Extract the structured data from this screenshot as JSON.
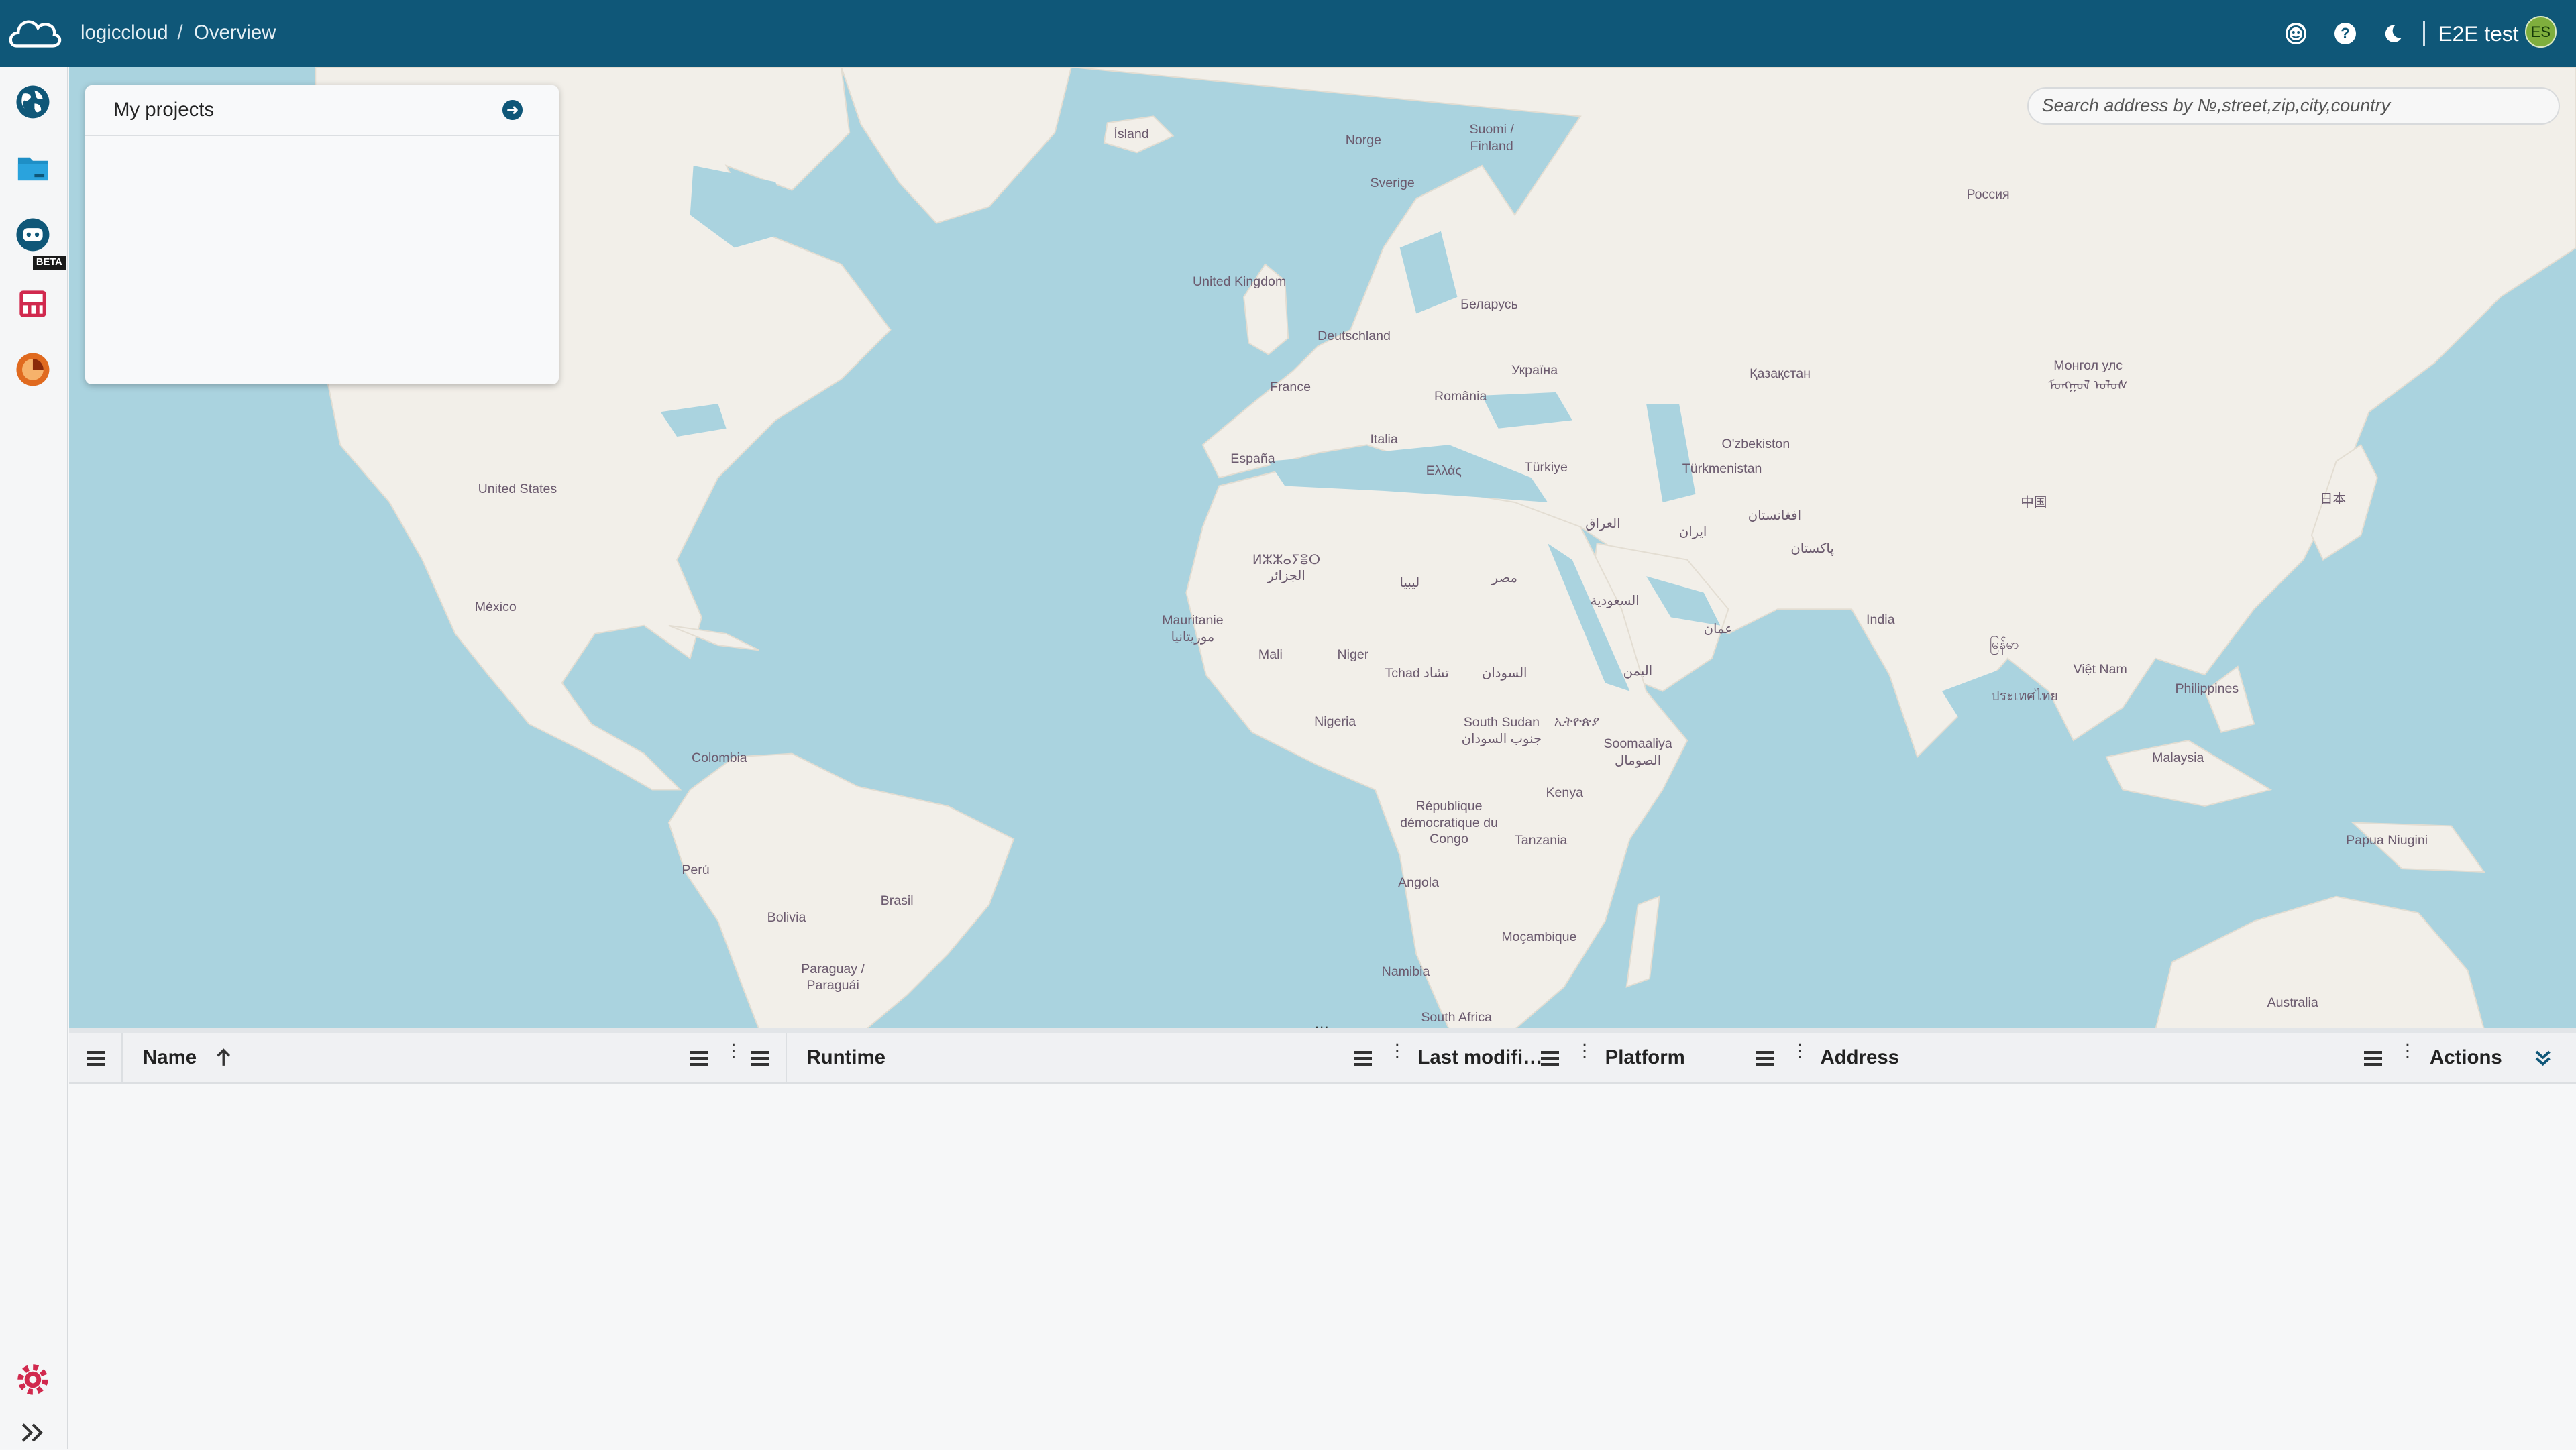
{
  "header": {
    "app_name": "logiccloud",
    "separator": "/",
    "page": "Overview",
    "user_name": "E2E test",
    "user_initials": "ES",
    "icons": [
      "feedback-icon",
      "help-icon",
      "dark-mode-icon"
    ]
  },
  "sidebar": {
    "items": [
      {
        "name": "map",
        "icon": "globe-icon"
      },
      {
        "name": "projects",
        "icon": "folder-icon"
      },
      {
        "name": "assistant",
        "icon": "robot-icon",
        "badge": "BETA"
      },
      {
        "name": "devices",
        "icon": "device-icon"
      },
      {
        "name": "analytics",
        "icon": "chart-icon"
      }
    ],
    "bottom": [
      {
        "name": "settings",
        "icon": "gear-icon"
      },
      {
        "name": "expand",
        "icon": "double-chevron-right-icon"
      }
    ]
  },
  "projects_card": {
    "title": "My projects"
  },
  "search": {
    "placeholder": "Search address by №,street,zip,city,country"
  },
  "map_labels": {
    "island": "Ísland",
    "norge": "Norge",
    "finland": "Suomi / Finland",
    "sverige": "Sverige",
    "russia": "Россия",
    "uk": "United Kingdom",
    "belarus": "Беларусь",
    "deutschland": "Deutschland",
    "ukraine": "Україна",
    "kazakhstan": "Қазақстан",
    "mongolia": "Монгол улс ᠮᠤᠩᠭᠤᠯ ᠤᠯᠤᠰ",
    "france": "France",
    "romania": "România",
    "uzbekistan": "O'zbekiston",
    "turkmenistan": "Türkmenistan",
    "italia": "Italia",
    "espana": "España",
    "ellas": "Ελλάς",
    "turkiye": "Türkiye",
    "china": "中国",
    "japan": "日本",
    "iraq": "العراق",
    "iran": "ایران",
    "afghanistan": "افغانستان",
    "pakistan": "پاکستان",
    "usa": "United States",
    "algeria": "ⵍⵣⵣⴰⵢⴻⵔ الجزائر",
    "libya": "ليبيا",
    "egypt": "مصر",
    "saudi": "السعودية",
    "india": "India",
    "myanmar": "မြန်မာ",
    "mexico": "México",
    "mauritanie": "Mauritanie موريتانيا",
    "oman": "عمان",
    "mali": "Mali",
    "niger": "Niger",
    "tchad": "Tchad تشاد",
    "sudan": "السودان",
    "yemen": "اليمن",
    "vietnam": "Việt Nam",
    "thailand": "ประเทศไทย",
    "philippines": "Philippines",
    "nigeria": "Nigeria",
    "south_sudan": "South Sudan جنوب السودان",
    "ethiopia": "ኢትዮጵያ",
    "somalia": "Soomaaliya الصومال",
    "colombia": "Colombia",
    "malaysia": "Malaysia",
    "kenya": "Kenya",
    "drc": "République démocratique du Congo",
    "tanzania": "Tanzania",
    "peru": "Perú",
    "brasil": "Brasil",
    "png": "Papua Niugini",
    "bolivia": "Bolivia",
    "angola": "Angola",
    "mocambique": "Moçambique",
    "paraguay": "Paraguay / Paraguái",
    "namibia": "Namibia",
    "south_africa": "South Africa",
    "australia": "Australia"
  },
  "grid": {
    "columns": [
      {
        "label": "Name",
        "sort": "ascending"
      },
      {
        "label": "Runtime"
      },
      {
        "label": "Last modifi…"
      },
      {
        "label": "Platform"
      },
      {
        "label": "Address"
      },
      {
        "label": "Actions"
      }
    ],
    "rows": []
  },
  "colors": {
    "header_bg": "#0f5778",
    "map_water": "#aad3df",
    "map_land": "#f2efe9",
    "avatar_bg": "#7fae3d"
  }
}
